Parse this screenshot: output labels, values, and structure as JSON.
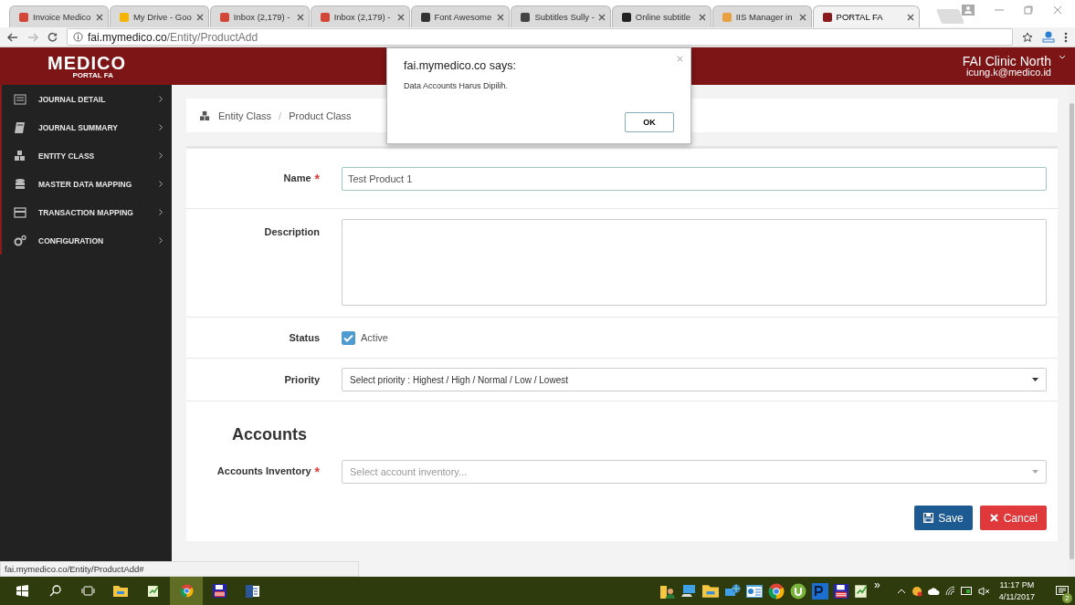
{
  "browser": {
    "tabs": [
      {
        "label": "Invoice Medico",
        "selected": false
      },
      {
        "label": "My Drive - Goo",
        "selected": false
      },
      {
        "label": "Inbox (2,179) -",
        "selected": false
      },
      {
        "label": "Inbox (2,179) -",
        "selected": false
      },
      {
        "label": "Font Awesome",
        "selected": false
      },
      {
        "label": "Subtitles Sully -",
        "selected": false
      },
      {
        "label": "Online subtitle",
        "selected": false
      },
      {
        "label": "IIS Manager in",
        "selected": false
      },
      {
        "label": "PORTAL FA",
        "selected": true
      }
    ],
    "address": {
      "host": "fai.mymedico.co",
      "path": "/Entity/ProductAdd"
    }
  },
  "header": {
    "logo": "MEDICO",
    "logo_sub": "PORTAL FA",
    "clinic": "FAI Clinic North",
    "email": "icung.k@medico.id"
  },
  "sidebar": {
    "items": [
      {
        "label": "JOURNAL DETAIL"
      },
      {
        "label": "JOURNAL SUMMARY"
      },
      {
        "label": "ENTITY CLASS"
      },
      {
        "label": "MASTER DATA MAPPING"
      },
      {
        "label": "TRANSACTION MAPPING"
      },
      {
        "label": "CONFIGURATION"
      }
    ]
  },
  "breadcrumb": {
    "items": [
      "Entity Class",
      "Product Class"
    ],
    "separator": "/"
  },
  "form": {
    "fields": [
      {
        "kind": "text",
        "label": "Name",
        "required_mark": "*",
        "value": "Test Product 1"
      },
      {
        "kind": "textarea",
        "label": "Description"
      },
      {
        "kind": "checkbox",
        "label": "Status",
        "option": "Active",
        "checked": true
      },
      {
        "kind": "select",
        "label": "Priority",
        "value": "Select priority : Highest / High / Normal / Low / Lowest"
      },
      {
        "kind": "heading",
        "label": "Accounts"
      },
      {
        "kind": "combo",
        "label": "Accounts Inventory",
        "required_mark": "*",
        "placeholder": "Select account inventory..."
      }
    ],
    "buttons": [
      {
        "kind": "save",
        "label": "Save"
      },
      {
        "kind": "cancel",
        "label": "Cancel"
      }
    ]
  },
  "dialog": {
    "title": "fai.mymedico.co says:",
    "message": "Data Accounts Harus Dipilih.",
    "button": "OK"
  },
  "status_url": "fai.mymedico.co/Entity/ProductAdd#",
  "taskbar": {
    "overflow": "»",
    "time": "11:17 PM",
    "date": "4/11/2017",
    "notifications": "2"
  }
}
